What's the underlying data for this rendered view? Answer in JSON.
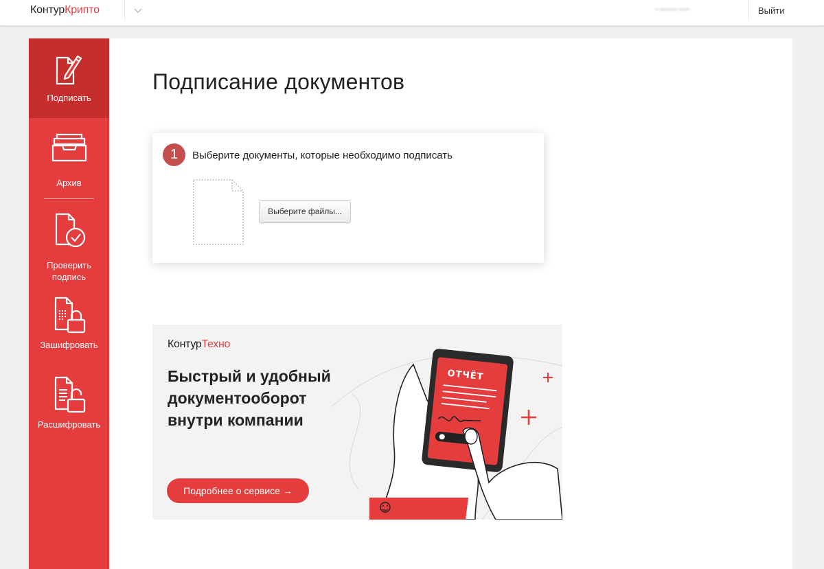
{
  "header": {
    "logo_part1": "Контур",
    "logo_part2": "Крипто",
    "user_name": "• •••••••• •••••",
    "logout_label": "Выйти"
  },
  "sidebar": {
    "items": [
      {
        "label": "Подписать",
        "icon": "sign-document-icon",
        "active": true
      },
      {
        "label": "Архив",
        "icon": "archive-tray-icon",
        "active": false
      },
      {
        "label": "Проверить подпись",
        "icon": "verify-signature-icon",
        "active": false
      },
      {
        "label": "Зашифровать",
        "icon": "encrypt-document-icon",
        "active": false
      },
      {
        "label": "Расшифровать",
        "icon": "decrypt-document-icon",
        "active": false
      }
    ]
  },
  "main": {
    "title": "Подписание документов",
    "step": {
      "number": "1",
      "text": "Выберите документы, которые необходимо подписать",
      "choose_button": "Выберите файлы..."
    }
  },
  "promo": {
    "brand_part1": "Контур",
    "brand_part2": "Техно",
    "headline_line1": "Быстрый и удобный",
    "headline_line2": "документооборот",
    "headline_line3": "внутри компании",
    "button_label": "Подробнее о сервисе →",
    "phone_label": "ОТЧЁТ"
  },
  "colors": {
    "brand_red": "#e53d3d",
    "active_red": "#c62d2d",
    "badge_red": "#c44d4d"
  }
}
